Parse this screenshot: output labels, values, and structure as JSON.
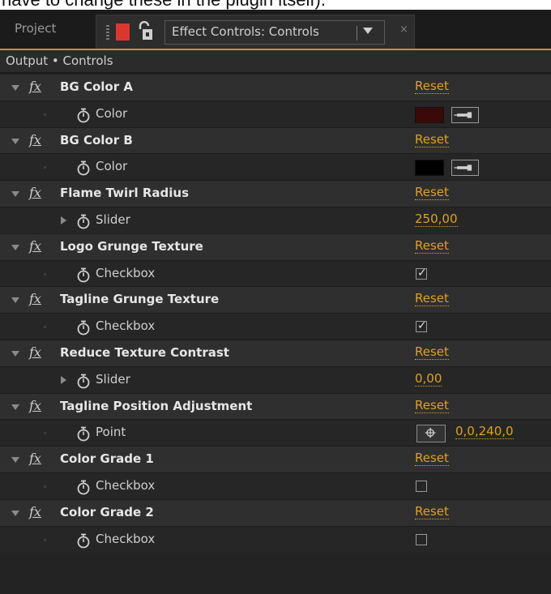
{
  "caption": "have to change these in the plugin itself).",
  "tabs": {
    "project": "Project",
    "effect_controls": "Effect Controls: Controls",
    "close": "×"
  },
  "breadcrumb": "Output • Controls",
  "effects": [
    {
      "name": "BG Color A",
      "reset": "Reset",
      "param": "Color",
      "value": "",
      "swatch": "#3a0a0a"
    },
    {
      "name": "BG Color B",
      "reset": "Reset",
      "param": "Color",
      "value": "",
      "swatch": "#000000"
    },
    {
      "name": "Flame Twirl Radius",
      "reset": "Reset",
      "param": "Slider",
      "value": "250,00"
    },
    {
      "name": "Logo Grunge Texture",
      "reset": "Reset",
      "param": "Checkbox",
      "checked": true
    },
    {
      "name": "Tagline Grunge Texture",
      "reset": "Reset",
      "param": "Checkbox",
      "checked": true
    },
    {
      "name": "Reduce Texture Contrast",
      "reset": "Reset",
      "param": "Slider",
      "value": "0,00"
    },
    {
      "name": "Tagline Position Adjustment",
      "reset": "Reset",
      "param": "Point",
      "value": "0,0,240,0"
    },
    {
      "name": "Color Grade 1",
      "reset": "Reset",
      "param": "Checkbox",
      "checked": false
    },
    {
      "name": "Color Grade 2",
      "reset": "Reset",
      "param": "Checkbox",
      "checked": false
    }
  ],
  "checkmark": "✓",
  "colors": {
    "accent": "#e0a020",
    "tab_marker": "#d9382f"
  }
}
